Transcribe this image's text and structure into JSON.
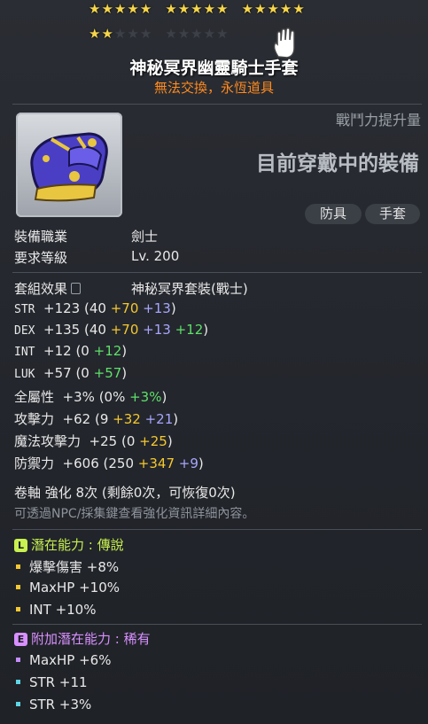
{
  "stars": {
    "filled": 17,
    "total": 25
  },
  "item": {
    "name": "神秘冥界幽靈騎士手套",
    "trade_note": "無法交換，永恆道具",
    "icon": "glove-icon"
  },
  "header": {
    "cp_label": "戰鬥力提升量",
    "equipped_label": "目前穿戴中的裝備",
    "tag_armor": "防具",
    "tag_glove": "手套"
  },
  "req": {
    "job_label": "裝備職業",
    "job_value": "劍士",
    "level_label": "要求等級",
    "level_value": "Lv. 200"
  },
  "set": {
    "label": "套組效果",
    "value": "神秘冥界套裝(戰士)"
  },
  "stats": [
    {
      "name": "STR",
      "total": "+123",
      "parts": [
        {
          "t": "(40 ",
          "c": "base"
        },
        {
          "t": "+70 ",
          "c": "yellow"
        },
        {
          "t": "+13",
          "c": "purple"
        },
        {
          "t": ")",
          "c": "base"
        }
      ]
    },
    {
      "name": "DEX",
      "total": "+135",
      "parts": [
        {
          "t": "(40 ",
          "c": "base"
        },
        {
          "t": "+70 ",
          "c": "yellow"
        },
        {
          "t": "+13 ",
          "c": "purple"
        },
        {
          "t": "+12",
          "c": "green"
        },
        {
          "t": ")",
          "c": "base"
        }
      ]
    },
    {
      "name": "INT",
      "total": "+12",
      "parts": [
        {
          "t": "(0 ",
          "c": "base"
        },
        {
          "t": "+12",
          "c": "green"
        },
        {
          "t": ")",
          "c": "base"
        }
      ]
    },
    {
      "name": "LUK",
      "total": "+57",
      "parts": [
        {
          "t": "(0 ",
          "c": "base"
        },
        {
          "t": "+57",
          "c": "green"
        },
        {
          "t": ")",
          "c": "base"
        }
      ]
    },
    {
      "name": "全屬性",
      "total": "+3%",
      "parts": [
        {
          "t": "(0% ",
          "c": "base"
        },
        {
          "t": "+3%",
          "c": "green"
        },
        {
          "t": ")",
          "c": "base"
        }
      ]
    },
    {
      "name": "攻擊力",
      "total": "+62",
      "parts": [
        {
          "t": "(9 ",
          "c": "base"
        },
        {
          "t": "+32 ",
          "c": "yellow"
        },
        {
          "t": "+21",
          "c": "purple"
        },
        {
          "t": ")",
          "c": "base"
        }
      ]
    },
    {
      "name": "魔法攻擊力",
      "total": "+25",
      "parts": [
        {
          "t": "(0 ",
          "c": "base"
        },
        {
          "t": "+25",
          "c": "yellow"
        },
        {
          "t": ")",
          "c": "base"
        }
      ]
    },
    {
      "name": "防禦力",
      "total": "+606",
      "parts": [
        {
          "t": "(250 ",
          "c": "base"
        },
        {
          "t": "+347 ",
          "c": "yellow"
        },
        {
          "t": "+9",
          "c": "purple"
        },
        {
          "t": ")",
          "c": "base"
        }
      ]
    }
  ],
  "scroll": {
    "line": "卷軸 強化 8次 (剩餘0次，可恢復0次)",
    "note": "可透過NPC/採集鍵查看強化資訊詳細內容。"
  },
  "potential": {
    "badge": "L",
    "label": "潛在能力",
    "sep": " : ",
    "grade": "傳說",
    "lines": [
      "爆擊傷害 +8%",
      "MaxHP +10%",
      "INT +10%"
    ],
    "bullet_colors": [
      "#f5c830",
      "#f5c830",
      "#f5c830"
    ]
  },
  "bonus": {
    "badge": "E",
    "label": "附加潛在能力",
    "sep": " : ",
    "grade": "稀有",
    "lines": [
      "MaxHP +6%",
      "STR +11",
      "STR +3%"
    ],
    "bullet_colors": [
      "#c58cff",
      "#5fd6e6",
      "#5fd6e6"
    ]
  },
  "colors": {
    "star": "#f6d64a",
    "legendary": "#c8f050",
    "bonus": "#d890ff",
    "trade": "#ff8a1f"
  }
}
